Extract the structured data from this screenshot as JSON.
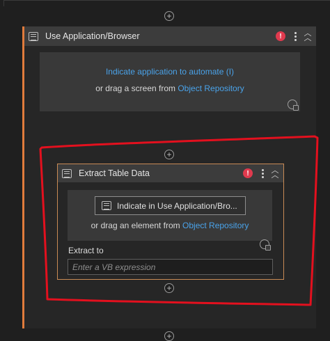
{
  "outer_activity": {
    "title": "Use Application/Browser",
    "error_badge": "!",
    "indicate_link": "Indicate application to automate (I)",
    "drag_prefix": "or drag a screen from ",
    "repository_link": "Object Repository"
  },
  "inner_activity": {
    "title": "Extract Table Data",
    "error_badge": "!",
    "indicate_button": "Indicate in Use Application/Bro...",
    "drag_prefix": "or drag an element from ",
    "repository_link": "Object Repository",
    "extract_to_label": "Extract to",
    "extract_to_placeholder": "Enter a VB expression"
  },
  "colors": {
    "accent_orange": "#e07b3c",
    "link_blue": "#4aa3ea",
    "error_red": "#e03a4e",
    "annotation_red": "#e3101e"
  }
}
